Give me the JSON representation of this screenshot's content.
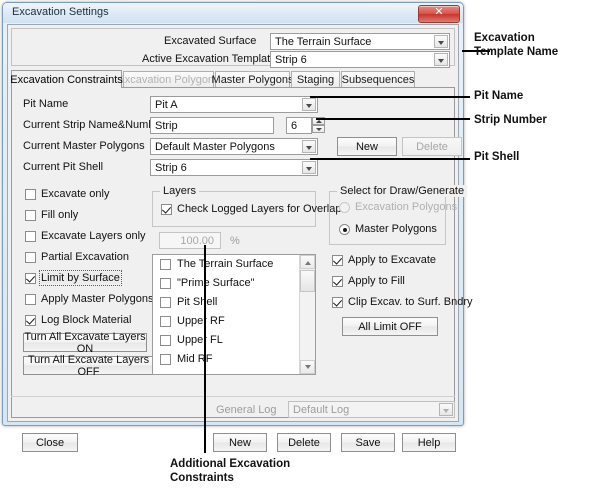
{
  "window": {
    "title": "Excavation Settings",
    "close_label": "✕"
  },
  "top_panel": {
    "excavated_surface_label": "Excavated Surface",
    "excavated_surface_value": "The Terrain Surface",
    "active_template_label": "Active Excavation Template",
    "active_template_value": "Strip 6"
  },
  "tabs": [
    {
      "label": "Excavation Constraints",
      "active": true,
      "disabled": false
    },
    {
      "label": "Excavation Polygons",
      "active": false,
      "disabled": true
    },
    {
      "label": "Master Polygons",
      "active": false,
      "disabled": false
    },
    {
      "label": "Staging",
      "active": false,
      "disabled": false
    },
    {
      "label": "Subsequences",
      "active": false,
      "disabled": false
    }
  ],
  "form": {
    "pit_name_label": "Pit Name",
    "pit_name_value": "Pit A",
    "strip_label": "Current Strip Name&Number",
    "strip_name_value": "Strip",
    "strip_number_value": "6",
    "master_polygons_label": "Current Master Polygons",
    "master_polygons_value": "Default Master Polygons",
    "pit_shell_label": "Current Pit Shell",
    "pit_shell_value": "Strip 6",
    "new_button": "New",
    "delete_button": "Delete"
  },
  "constraints": [
    {
      "label": "Excavate only",
      "checked": false,
      "focus": false
    },
    {
      "label": "Fill only",
      "checked": false,
      "focus": false
    },
    {
      "label": "Excavate Layers only",
      "checked": false,
      "focus": false
    },
    {
      "label": "Partial Excavation",
      "checked": false,
      "focus": false
    },
    {
      "label": "Limit by Surface",
      "checked": true,
      "focus": true
    },
    {
      "label": "Apply Master Polygons",
      "checked": false,
      "focus": false
    },
    {
      "label": "Log Block Material",
      "checked": true,
      "focus": false
    }
  ],
  "layer_buttons": {
    "all_on": "Turn All Excavate Layers ON",
    "all_off": "Turn All Excavate Layers OFF"
  },
  "layers_group": {
    "title": "Layers",
    "check_overlap_label": "Check Logged Layers for Overlap",
    "check_overlap_checked": true,
    "percent_value": "100.00",
    "percent_symbol": "%",
    "items": [
      {
        "label": "The Terrain Surface",
        "checked": false
      },
      {
        "label": "\"Prime Surface\"",
        "checked": false
      },
      {
        "label": "Pit Shell",
        "checked": false
      },
      {
        "label": "Upper RF",
        "checked": false
      },
      {
        "label": "Upper FL",
        "checked": false
      },
      {
        "label": "Mid RF",
        "checked": false
      }
    ]
  },
  "draw_group": {
    "title": "Select for Draw/Generate",
    "options": [
      {
        "label": "Excavation Polygons",
        "selected": false,
        "disabled": true
      },
      {
        "label": "Master Polygons",
        "selected": true,
        "disabled": false
      }
    ]
  },
  "apply_options": [
    {
      "label": "Apply to Excavate",
      "checked": true
    },
    {
      "label": "Apply to Fill",
      "checked": true
    },
    {
      "label": "Clip Excav. to Surf. Bndry",
      "checked": true
    }
  ],
  "all_limit_off_button": "All Limit OFF",
  "footer": {
    "general_log_label": "General Log",
    "general_log_value": "Default Log",
    "close_button": "Close",
    "new_button": "New",
    "delete_button": "Delete",
    "save_button": "Save",
    "help_button": "Help"
  },
  "annotations": {
    "template_name": "Excavation\nTemplate Name",
    "template_name_l1": "Excavation",
    "template_name_l2": "Template Name",
    "pit_name": "Pit Name",
    "strip_number": "Strip Number",
    "pit_shell": "Pit Shell",
    "additional_l1": "Additional Excavation",
    "additional_l2": "Constraints"
  }
}
